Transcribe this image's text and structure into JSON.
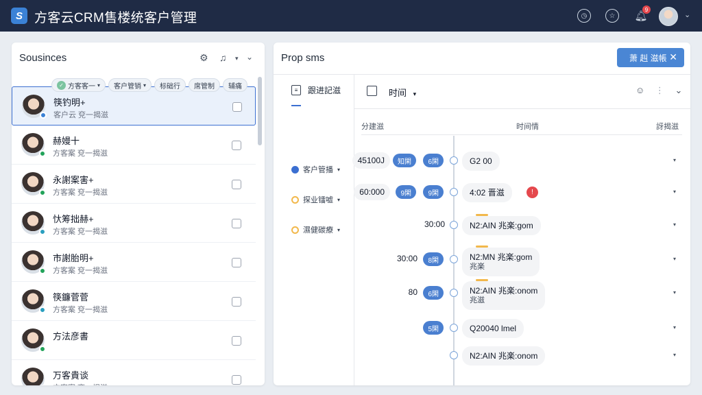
{
  "header": {
    "logo_glyph": "S",
    "title": "方客云CRM售楼统客户管理",
    "notification_count": "9",
    "accent": "#1f2b45"
  },
  "left_panel": {
    "title": "Sousinces",
    "chips": [
      {
        "label": "方客客一",
        "caret": "▾"
      },
      {
        "label": "客户管销",
        "caret": "▾"
      },
      {
        "label": "标础行",
        "caret": ""
      },
      {
        "label": "席管制",
        "caret": ""
      },
      {
        "label": "辅痛",
        "caret": ""
      }
    ],
    "contacts": [
      {
        "name": "筷钓明+",
        "sub": "客户云 兗一揭滋",
        "status_color": "#3b82d6",
        "selected": true
      },
      {
        "name": "赫嫚十",
        "sub": "方客案 兗一揭滋",
        "status_color": "#22a35a",
        "selected": false
      },
      {
        "name": "永謝案害+",
        "sub": "方客案 兗一揭滋",
        "status_color": "#22a35a",
        "selected": false
      },
      {
        "name": "忕筹拙赫+",
        "sub": "方客案 兗一揭滋",
        "status_color": "#2a9fbf",
        "selected": false
      },
      {
        "name": "市謝胎明+",
        "sub": "方客案 兗一揭滋",
        "status_color": "#22a35a",
        "selected": false
      },
      {
        "name": "筷鐮菅菅",
        "sub": "方客案 兗一揭滋",
        "status_color": "#2a9fbf",
        "selected": false
      },
      {
        "name": "方法彦書",
        "sub": "",
        "status_color": "#22a35a",
        "selected": false
      },
      {
        "name": "万客貴谈",
        "sub": "方客案 兗一揭滋",
        "status_color": "#3b82d6",
        "selected": false
      }
    ]
  },
  "right_panel": {
    "title": "Prop sms",
    "action_button": "萧 赳 滋帳",
    "subnav_title": "跟进記滋",
    "filters": [
      {
        "label": "客户管播",
        "caret": "▾",
        "color": "#3b6fd1"
      },
      {
        "label": "探业镭嘘",
        "caret": "▾",
        "color": "#f2b84b"
      },
      {
        "label": "濕健碳療",
        "caret": "▾",
        "color": "#f2b84b"
      }
    ],
    "toolbar_label": "时间",
    "columns": [
      "分建滋",
      "时间情",
      "訝揭滋"
    ],
    "timeline": [
      {
        "time": "45100J",
        "pills": [
          "知閑",
          "6閑"
        ],
        "card": "G2 00",
        "card_sub": "",
        "bar": false,
        "alert": false
      },
      {
        "time": "60:000",
        "pills": [
          "9閑",
          "9閑"
        ],
        "card": "4:02 晋滋",
        "card_sub": "",
        "bar": false,
        "alert": true
      },
      {
        "time": "30:00",
        "pills": [],
        "card": "N2:AIN 兆楽:gom",
        "card_sub": "",
        "bar": true,
        "alert": false
      },
      {
        "time": "30:00",
        "pills": [
          "8閑"
        ],
        "card": "N2:MN 兆楽:gom",
        "card_sub": "兆楽",
        "bar": true,
        "alert": false
      },
      {
        "time": "80",
        "pills": [
          "6閑"
        ],
        "card": "N2:AIN 兆楽:onom",
        "card_sub": "兆滋",
        "bar": true,
        "alert": false
      },
      {
        "time": "",
        "pills": [
          "5閑"
        ],
        "card": "Q20040 lmel",
        "card_sub": "",
        "bar": false,
        "alert": false
      },
      {
        "time": "",
        "pills": [],
        "card": "N2:AIN 兆楽:onom",
        "card_sub": "",
        "bar": false,
        "alert": false
      }
    ],
    "alert_glyph": "!"
  }
}
